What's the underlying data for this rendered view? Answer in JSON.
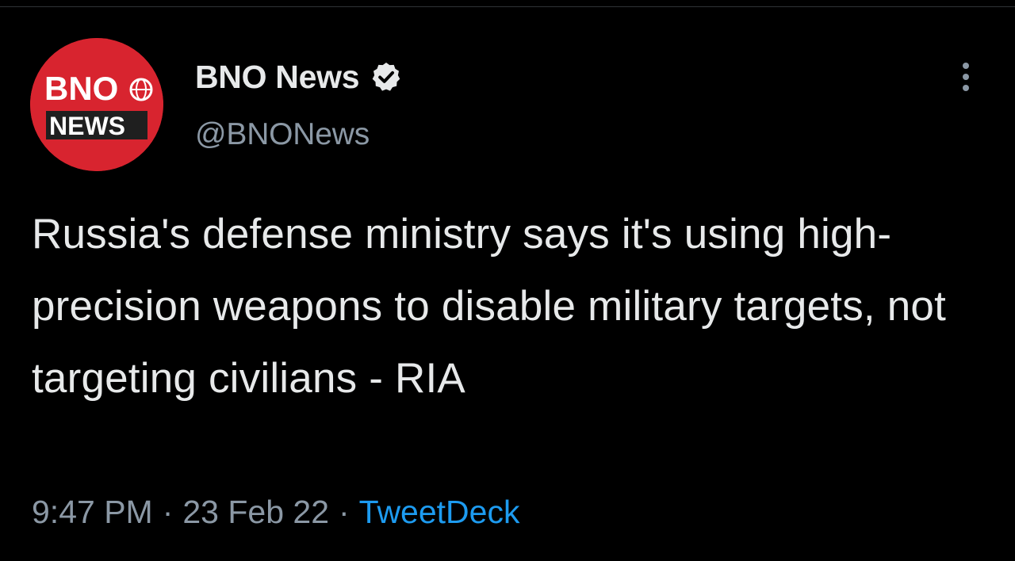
{
  "tweet": {
    "author": {
      "display_name": "BNO News",
      "handle": "@BNONews",
      "verified": true,
      "avatar": {
        "line1": "BNO",
        "line2": "NEWS",
        "bg_color": "#d8242f"
      }
    },
    "text": "Russia's defense ministry says it's using high-precision weapons to disable military targets, not targeting civilians - RIA",
    "time": "9:47 PM",
    "date": "23 Feb 22",
    "separator": "·",
    "source": "TweetDeck"
  },
  "icons": {
    "verified": "verified-badge-icon",
    "more": "more-vertical-icon",
    "globe": "globe-icon"
  },
  "colors": {
    "background": "#000000",
    "text_primary": "#e7e9ea",
    "text_secondary": "#8b98a5",
    "link": "#1d9bf0",
    "brand_red": "#d8242f"
  }
}
